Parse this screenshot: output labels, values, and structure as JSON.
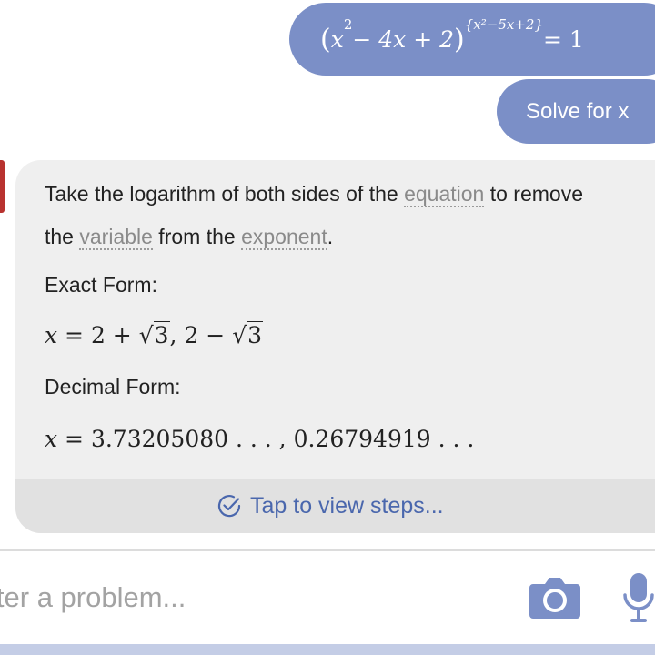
{
  "conversation": {
    "user_equation": {
      "base_open": "(",
      "base_terms": "x",
      "base_exp": "2",
      "base_rest": " − 4x + 2",
      "base_close": ")",
      "exponent": "{x²−5x+2}",
      "rhs": " = 1"
    },
    "user_request": "Solve for x"
  },
  "answer": {
    "explanation_parts": [
      "Take the logarithm of both sides of the ",
      "equation",
      " to remove the ",
      "variable",
      " from the ",
      "exponent",
      "."
    ],
    "exact_form_label": "Exact Form:",
    "exact_form": {
      "var": "x",
      "eq": " = 2 + ",
      "root1": "3",
      "sep": ", 2 − ",
      "root2": "3"
    },
    "decimal_form_label": "Decimal Form:",
    "decimal_form": {
      "var": "x",
      "value": " = 3.73205080 . . . , 0.26794919 . . ."
    },
    "steps_link": "Tap to view steps..."
  },
  "input": {
    "placeholder": "Enter a problem..."
  },
  "colors": {
    "user_bubble": "#7b8fc7",
    "card_bg": "#efefef",
    "steps_bar": "#e1e1e1",
    "accent": "#4a67ad",
    "red_tab": "#b8322f"
  },
  "icons": {
    "steps": "check-circle-icon",
    "camera": "camera-icon",
    "mic": "microphone-icon"
  }
}
